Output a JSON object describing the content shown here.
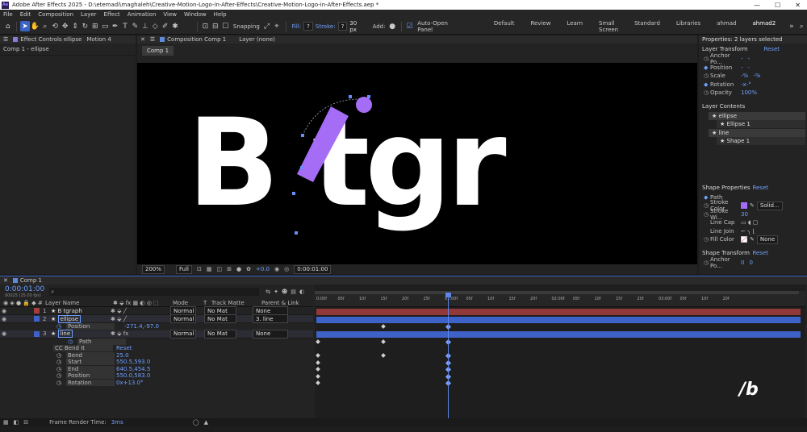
{
  "window": {
    "title": "Adobe After Effects 2025 - D:\\etemadi\\maghaleh\\Creative-Motion-Logo-in-After-Effects\\Creative-Motion-Logo-in-After-Effects.aep *",
    "app_icon": "Ae",
    "minimize": "—",
    "maximize": "☐",
    "close": "✕"
  },
  "menu": [
    "File",
    "Edit",
    "Composition",
    "Layer",
    "Effect",
    "Animation",
    "View",
    "Window",
    "Help"
  ],
  "toolbar": {
    "snapping": "Snapping",
    "fill": "Fill:",
    "fill_value": "?",
    "stroke": "Stroke:",
    "stroke_value": "?",
    "stroke_px": "30 px",
    "add": "Add:",
    "auto_open": "Auto-Open Panel"
  },
  "workspaces": [
    "Default",
    "Review",
    "Learn",
    "Small Screen",
    "Standard",
    "Libraries",
    "ahmad",
    "ahmad2"
  ],
  "left_panel": {
    "tab": "Effect Controls ellipse",
    "tab2": "Motion 4",
    "header": "Comp 1 - ellipse"
  },
  "viewer": {
    "tab": "Composition Comp 1",
    "layer_tab": "Layer (none)",
    "comp_button": "Comp 1",
    "canvas_text": "B tgr",
    "zoom": "200%",
    "quality": "Full",
    "offset": "+0.0",
    "timecode": "0:00:01:00"
  },
  "properties": {
    "title": "Properties: 2 layers selected",
    "layer_transform": "Layer Transform",
    "reset": "Reset",
    "transform": [
      {
        "label": "Anchor Po...",
        "v1": "-",
        "v2": "-"
      },
      {
        "label": "Position",
        "v1": "-",
        "v2": "-"
      },
      {
        "label": "Scale",
        "v1": "-%",
        "v2": "-%"
      },
      {
        "label": "Rotation",
        "v1": "-x-°",
        "v2": ""
      },
      {
        "label": "Opacity",
        "v1": "100%",
        "v2": ""
      }
    ],
    "layer_contents": "Layer Contents",
    "contents": [
      {
        "name": "ellipse",
        "level": 0
      },
      {
        "name": "Ellipse 1",
        "level": 1
      },
      {
        "name": "line",
        "level": 0
      },
      {
        "name": "Shape 1",
        "level": 1
      }
    ],
    "shape_properties": "Shape Properties",
    "shape": [
      {
        "label": "Path",
        "v": ""
      },
      {
        "label": "Stroke Color",
        "v": "Solid..."
      },
      {
        "label": "Stroke Wi...",
        "v": "30"
      },
      {
        "label": "Line Cap",
        "v": ""
      },
      {
        "label": "Line Join",
        "v": ""
      },
      {
        "label": "Fill Color",
        "v": "None"
      }
    ],
    "shape_transform": "Shape Transform",
    "anchor": "Anchor Po...",
    "anchor_v1": "0",
    "anchor_v2": "0"
  },
  "timeline": {
    "tab": "Comp 1",
    "time": "0:00:01:00",
    "frames": "00025 (25.00 fps)",
    "search_placeholder": "",
    "headers": {
      "layer_name": "Layer Name",
      "mode": "Mode",
      "t": "T",
      "track_matte": "Track Matte",
      "parent": "Parent & Link"
    },
    "layers": [
      {
        "num": "1",
        "name": "B tgraph",
        "mode": "Normal",
        "matte": "No Mat",
        "parent": "None",
        "color": "#a63d3d"
      },
      {
        "num": "2",
        "name": "ellipse",
        "mode": "Normal",
        "matte": "No Mat",
        "parent": "3. line",
        "color": "#3f62c9"
      },
      {
        "num": "3",
        "name": "line",
        "mode": "Normal",
        "matte": "No Mat",
        "parent": "None",
        "color": "#3f62c9"
      }
    ],
    "props": [
      {
        "label": "Position",
        "value": "-271.4,-97.0",
        "indent": 3
      },
      {
        "label": "Path",
        "value": "",
        "indent": 4
      },
      {
        "label": "CC Bend It",
        "value": "Reset",
        "indent": 2
      },
      {
        "label": "Bend",
        "value": "25.0",
        "indent": 3
      },
      {
        "label": "Start",
        "value": "550.5,593.0",
        "indent": 3
      },
      {
        "label": "End",
        "value": "640.5,454.5",
        "indent": 3
      },
      {
        "label": "Position",
        "value": "550.0,583.0",
        "indent": 3
      },
      {
        "label": "Rotation",
        "value": "0x+13.0°",
        "indent": 3
      }
    ],
    "ruler": [
      "0:00f",
      "05f",
      "10f",
      "15f",
      "20f",
      "25f",
      "01:00f",
      "05f",
      "10f",
      "15f",
      "20f",
      "02:00f",
      "05f",
      "10f",
      "15f",
      "20f",
      "03:00f",
      "05f",
      "10f",
      "20f"
    ],
    "status": "Frame Render Time:",
    "render_time": "3ms"
  },
  "watermark": "/b",
  "colors": {
    "accent": "#4b7ff0",
    "purple": "#a56cf5",
    "timeline_blue": "#3f62c9",
    "timeline_red": "#a63d3d"
  }
}
